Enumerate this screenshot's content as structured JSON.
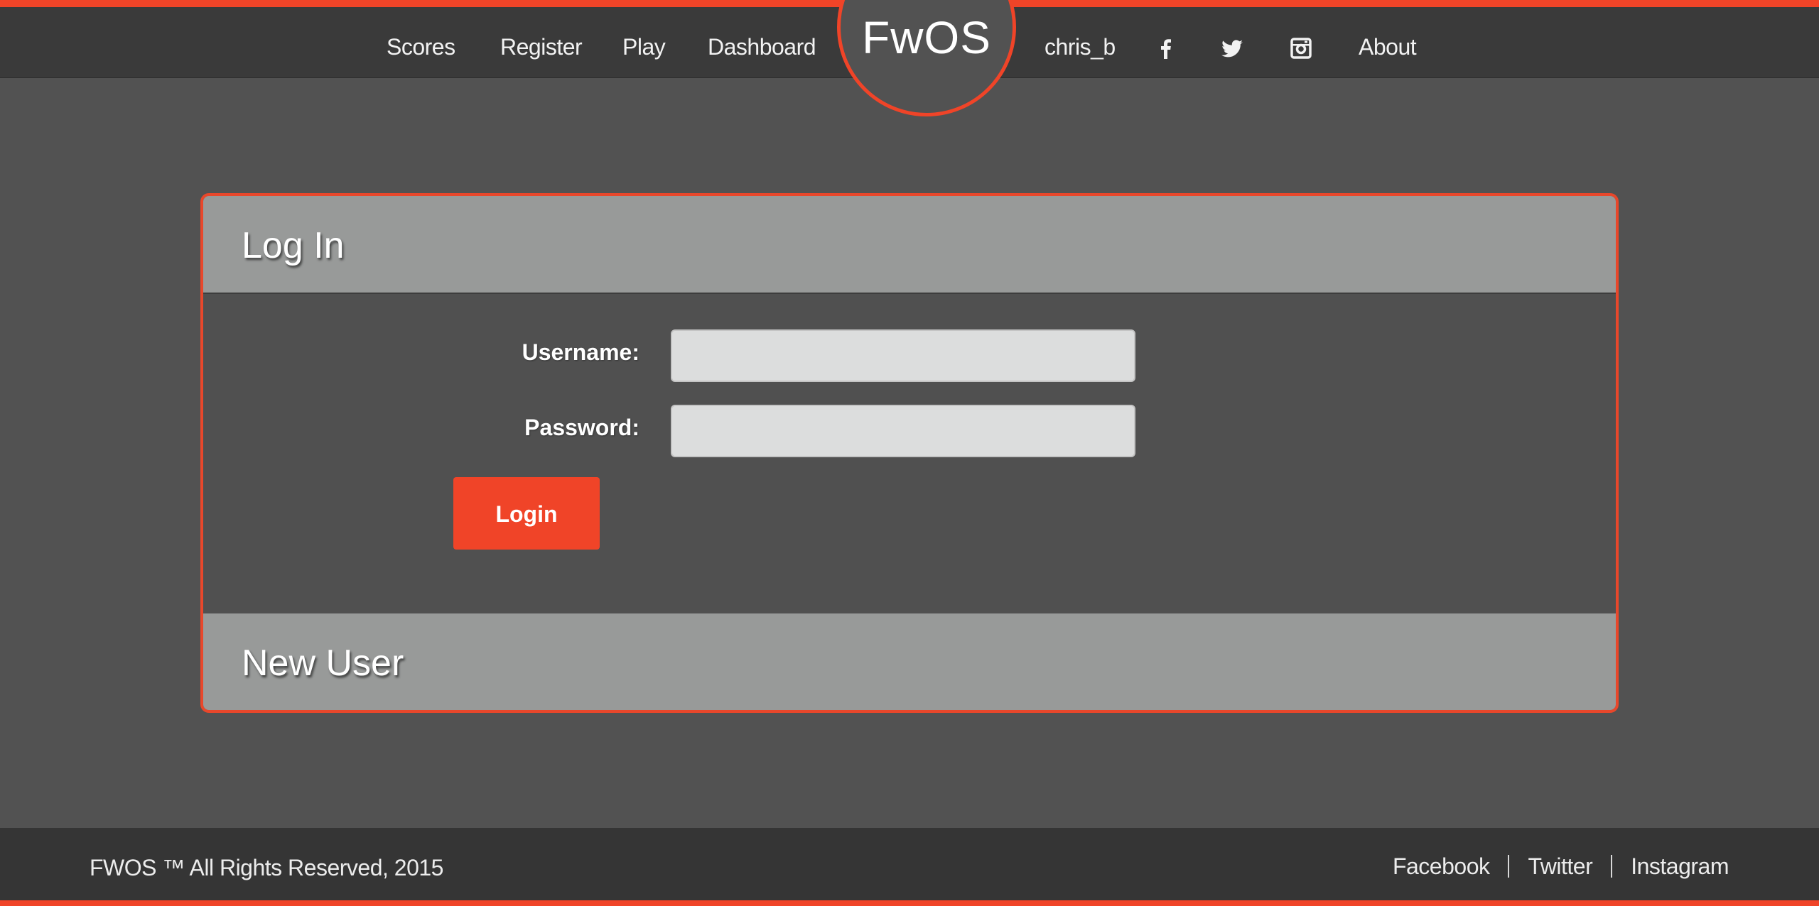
{
  "nav": {
    "left_items": [
      {
        "label": "Scores"
      },
      {
        "label": "Register"
      },
      {
        "label": "Play"
      },
      {
        "label": "Dashboard"
      }
    ],
    "logo": "FwOS",
    "user": "chris_b",
    "social_icons": [
      "facebook-icon",
      "twitter-icon",
      "instagram-icon"
    ],
    "about": "About"
  },
  "login_panel": {
    "title": "Log In",
    "username_label": "Username:",
    "username_value": "",
    "password_label": "Password:",
    "password_value": "",
    "login_button": "Login"
  },
  "new_user_panel": {
    "title": "New User"
  },
  "footer": {
    "copyright": "FWOS ™ All Rights Reserved, 2015",
    "links": [
      "Facebook",
      "Twitter",
      "Instagram"
    ]
  },
  "colors": {
    "accent": "#f04428",
    "nav_bg": "#3a3a3a",
    "page_bg": "#525252",
    "panel_header_bg": "#989a99",
    "input_bg": "#dcdddd"
  }
}
